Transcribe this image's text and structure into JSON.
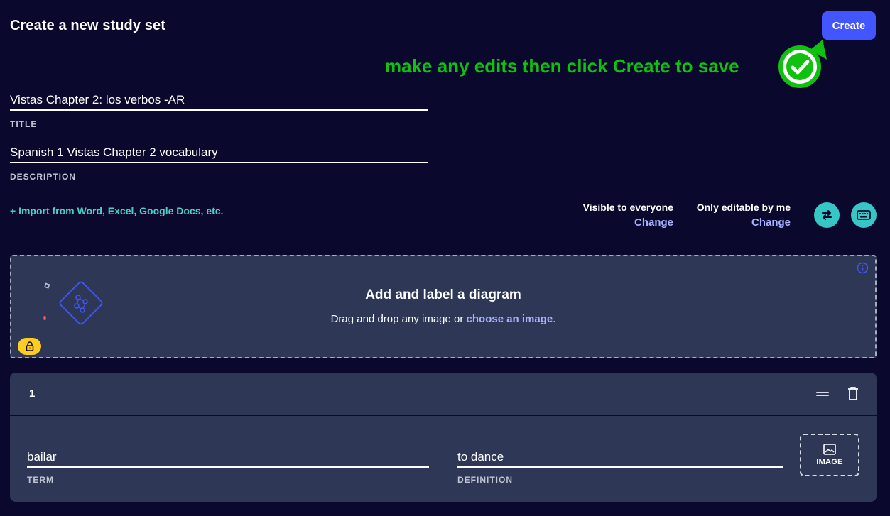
{
  "header": {
    "title": "Create a new study set",
    "create_label": "Create"
  },
  "annotation": {
    "hint": "make any edits then click Create to save",
    "accent": "#10c10f"
  },
  "form": {
    "title_value": "Vistas Chapter 2: los verbos -AR",
    "title_label": "TITLE",
    "description_value": "Spanish 1 Vistas Chapter 2 vocabulary",
    "description_label": "DESCRIPTION",
    "import_link": "+ Import from Word, Excel, Google Docs, etc."
  },
  "visibility": {
    "visible_label": "Visible to everyone",
    "visible_change": "Change",
    "editable_label": "Only editable by me",
    "editable_change": "Change",
    "icons": [
      "swap-arrows-icon",
      "keyboard-icon"
    ]
  },
  "diagram": {
    "title": "Add and label a diagram",
    "subtitle_prefix": "Drag and drop any image or ",
    "subtitle_link": "choose an image",
    "subtitle_suffix": "."
  },
  "cards": [
    {
      "number": "1",
      "term": "bailar",
      "term_label": "TERM",
      "definition": "to dance",
      "definition_label": "DEFINITION",
      "image_label": "IMAGE"
    }
  ],
  "colors": {
    "background": "#0a092d",
    "primary": "#4255ff",
    "teal": "#37c6c6",
    "panel": "#2e3856",
    "link": "#a8b1ff",
    "lock": "#ffcd1f"
  }
}
